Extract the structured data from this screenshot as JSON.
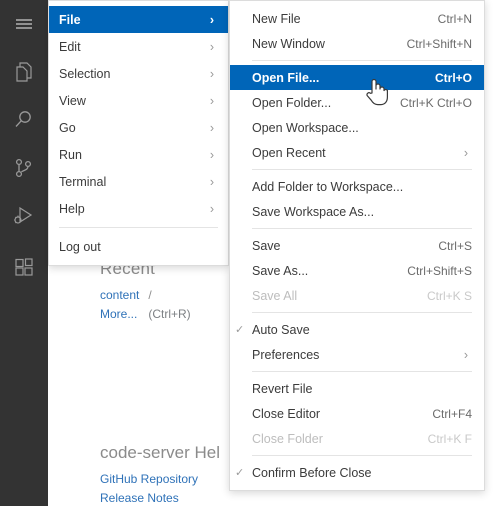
{
  "app": {
    "name": "code-server",
    "theme_accent": "#0065b8",
    "activity_bar_bg": "#333333",
    "menu_bg": "#ffffff"
  },
  "activity_bar": {
    "items": [
      {
        "icon": "hamburger-menu-icon",
        "label": "Application Menu"
      },
      {
        "icon": "files-explorer-icon",
        "label": "Explorer"
      },
      {
        "icon": "search-icon",
        "label": "Search"
      },
      {
        "icon": "source-control-icon",
        "label": "Source Control"
      },
      {
        "icon": "run-and-debug-icon",
        "label": "Run and Debug"
      },
      {
        "icon": "extensions-icon",
        "label": "Extensions"
      }
    ]
  },
  "welcome": {
    "recent_heading": "Recent",
    "recent_items": [
      {
        "name": "content",
        "path": "/"
      }
    ],
    "more_label": "More...",
    "more_shortcut": "(Ctrl+R)",
    "help_heading": "code-server Hel",
    "help_links": [
      "GitHub Repository",
      "Release Notes"
    ]
  },
  "main_menu": {
    "name": "application-menu",
    "items": [
      {
        "label": "File",
        "submenu": true,
        "selected": true
      },
      {
        "label": "Edit",
        "submenu": true,
        "selected": false
      },
      {
        "label": "Selection",
        "submenu": true,
        "selected": false
      },
      {
        "label": "View",
        "submenu": true,
        "selected": false
      },
      {
        "label": "Go",
        "submenu": true,
        "selected": false
      },
      {
        "label": "Run",
        "submenu": true,
        "selected": false
      },
      {
        "label": "Terminal",
        "submenu": true,
        "selected": false
      },
      {
        "label": "Help",
        "submenu": true,
        "selected": false
      },
      {
        "separator": true
      },
      {
        "label": "Log out",
        "submenu": false,
        "selected": false
      }
    ]
  },
  "file_menu": {
    "name": "file-submenu",
    "items": [
      {
        "label": "New File",
        "shortcut": "Ctrl+N"
      },
      {
        "label": "New Window",
        "shortcut": "Ctrl+Shift+N"
      },
      {
        "separator": true
      },
      {
        "label": "Open File...",
        "shortcut": "Ctrl+O",
        "selected": true
      },
      {
        "label": "Open Folder...",
        "shortcut": "Ctrl+K Ctrl+O"
      },
      {
        "label": "Open Workspace...",
        "shortcut": ""
      },
      {
        "label": "Open Recent",
        "shortcut": "",
        "submenu": true
      },
      {
        "separator": true
      },
      {
        "label": "Add Folder to Workspace...",
        "shortcut": ""
      },
      {
        "label": "Save Workspace As...",
        "shortcut": ""
      },
      {
        "separator": true
      },
      {
        "label": "Save",
        "shortcut": "Ctrl+S"
      },
      {
        "label": "Save As...",
        "shortcut": "Ctrl+Shift+S"
      },
      {
        "label": "Save All",
        "shortcut": "Ctrl+K S",
        "disabled": true
      },
      {
        "separator": true
      },
      {
        "label": "Auto Save",
        "shortcut": "",
        "checked": true
      },
      {
        "label": "Preferences",
        "shortcut": "",
        "submenu": true
      },
      {
        "separator": true
      },
      {
        "label": "Revert File",
        "shortcut": ""
      },
      {
        "label": "Close Editor",
        "shortcut": "Ctrl+F4"
      },
      {
        "label": "Close Folder",
        "shortcut": "Ctrl+K F",
        "disabled": true
      },
      {
        "separator": true
      },
      {
        "label": "Confirm Before Close",
        "shortcut": "",
        "checked": true
      }
    ]
  },
  "cursor": {
    "type": "pointer-hand-cursor"
  }
}
